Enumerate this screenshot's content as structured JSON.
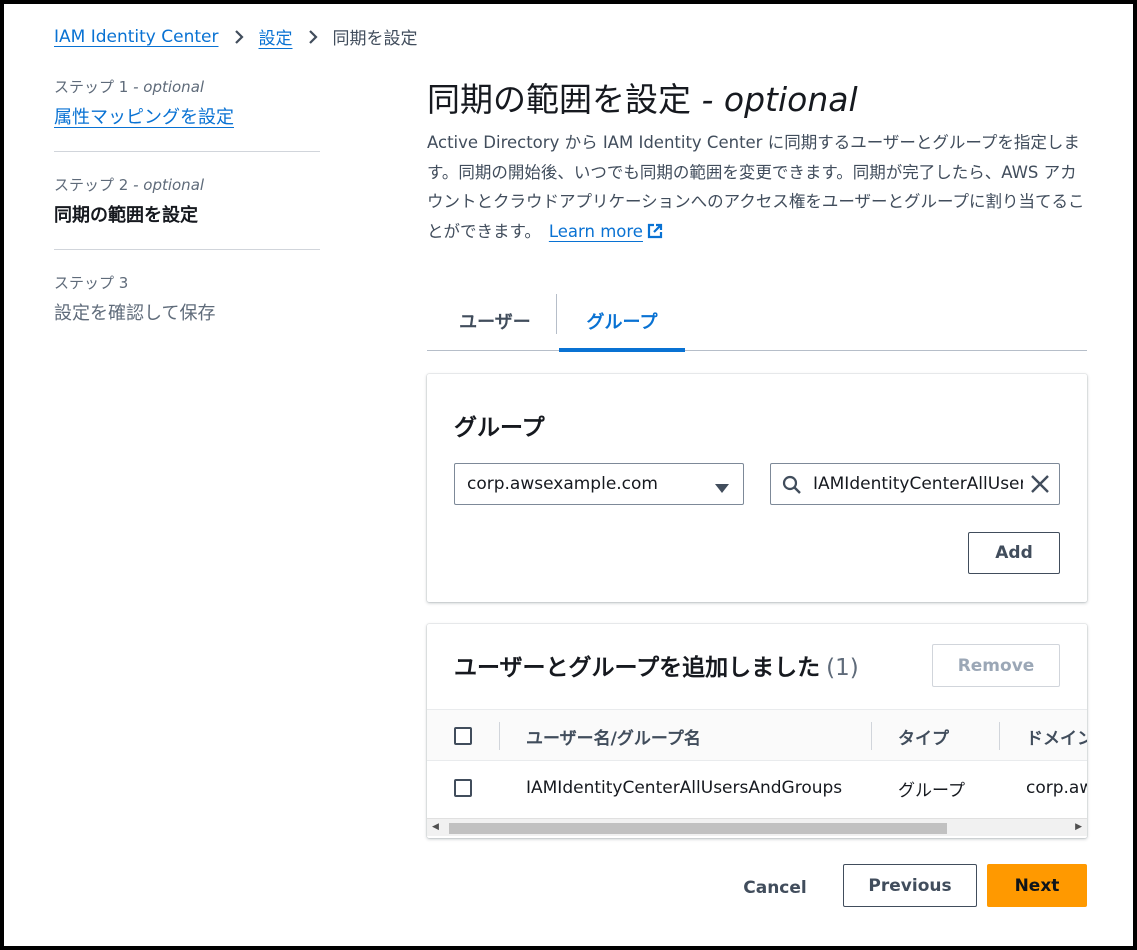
{
  "breadcrumb": {
    "items": [
      "IAM Identity Center",
      "設定"
    ],
    "current": "同期を設定"
  },
  "steps": [
    {
      "label_prefix": "ステップ 1",
      "label_suffix": " - optional",
      "title": "属性マッピングを設定"
    },
    {
      "label_prefix": "ステップ 2",
      "label_suffix": " - optional",
      "title": "同期の範囲を設定"
    },
    {
      "label_prefix": "ステップ 3",
      "label_suffix": "",
      "title": "設定を確認して保存"
    }
  ],
  "page": {
    "title": "同期の範囲を設定",
    "title_suffix": " - optional",
    "description": "Active Directory から IAM Identity Center に同期するユーザーとグループを指定します。同期の開始後、いつでも同期の範囲を変更できます。同期が完了したら、AWS アカウントとクラウドアプリケーションへのアクセス権をユーザーとグループに割り当てることができます。",
    "learn_more": "Learn more"
  },
  "tabs": {
    "users": "ユーザー",
    "groups": "グループ",
    "active": "groups"
  },
  "group_panel": {
    "heading": "グループ",
    "domain_select_value": "corp.awsexample.com",
    "search_value": "IAMIdentityCenterAllUsersAndGroups",
    "add_label": "Add"
  },
  "added_panel": {
    "title": "ユーザーとグループを追加しました",
    "count": "(1)",
    "remove_label": "Remove",
    "columns": [
      "ユーザー名/グループ名",
      "タイプ",
      "ドメイン"
    ],
    "rows": [
      {
        "name": "IAMIdentityCenterAllUsersAndGroups",
        "type": "グループ",
        "domain": "corp.awsexample.com"
      }
    ]
  },
  "footer": {
    "cancel": "Cancel",
    "previous": "Previous",
    "next": "Next"
  },
  "colors": {
    "link": "#0972d3",
    "primary_button": "#ff9900",
    "text": "#16191f"
  }
}
